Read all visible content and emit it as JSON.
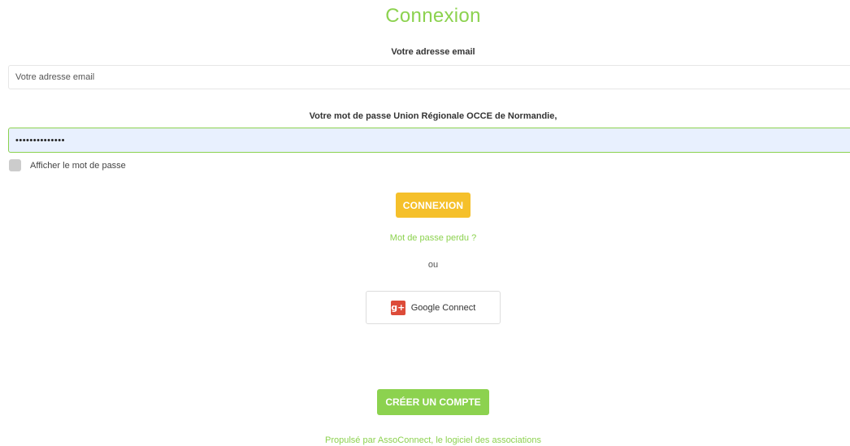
{
  "page": {
    "title": "Connexion"
  },
  "form": {
    "email_label": "Votre adresse email",
    "email_placeholder": "Votre adresse email",
    "email_value": "",
    "password_label": "Votre mot de passe Union Régionale OCCE de Normandie,",
    "password_value": "••••••••••••••",
    "show_password_label": "Afficher le mot de passe",
    "show_password_checked": false,
    "login_button": "CONNEXION",
    "lost_password_link": "Mot de passe perdu ?",
    "or_text": "ou",
    "google_button": "Google Connect",
    "google_icon": "g+",
    "create_account_button": "CRÉER UN COMPTE"
  },
  "footer": {
    "text": "Propulsé par AssoConnect, le logiciel des associations"
  },
  "colors": {
    "accent_green": "#8cd24f",
    "login_yellow": "#f5c02b",
    "google_red": "#dd4b39",
    "autofill_blue": "#e8f0fe"
  }
}
